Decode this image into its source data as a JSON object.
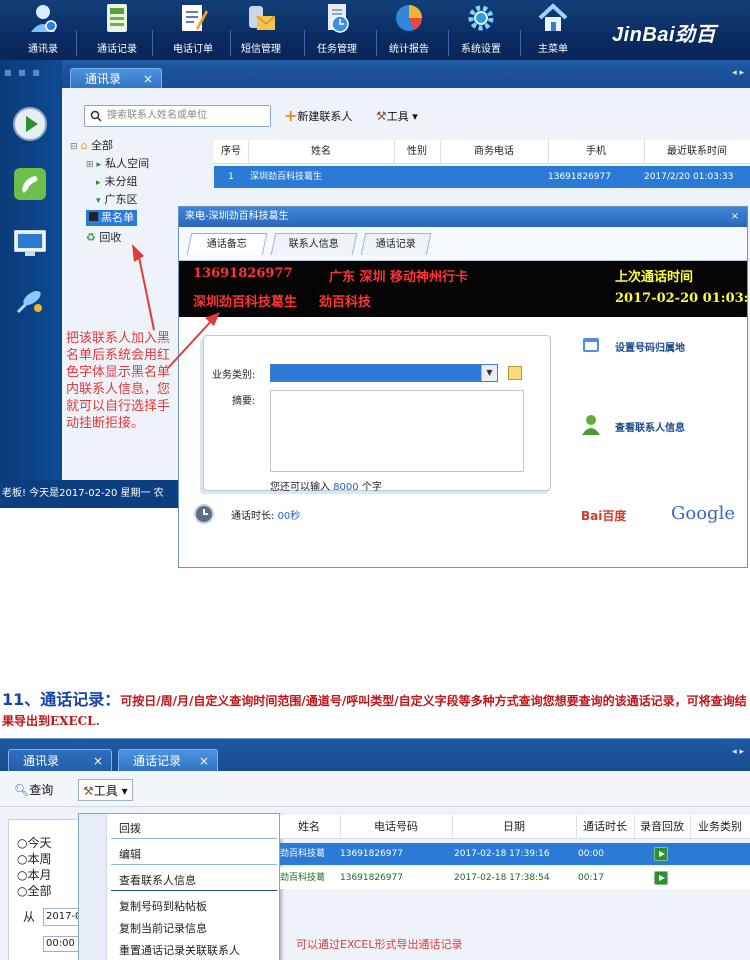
{
  "toolbar": {
    "items": [
      {
        "label": "通讯录",
        "icon": "address-book-icon"
      },
      {
        "label": "通话记录",
        "icon": "call-log-icon"
      },
      {
        "label": "电话订单",
        "icon": "order-icon"
      },
      {
        "label": "短信管理",
        "icon": "sms-icon"
      },
      {
        "label": "任务管理",
        "icon": "task-icon"
      },
      {
        "label": "统计报告",
        "icon": "pie-chart-icon"
      },
      {
        "label": "系统设置",
        "icon": "gear-icon"
      },
      {
        "label": "主菜单",
        "icon": "home-icon"
      }
    ],
    "brand": "JinBai劲百"
  },
  "sidebar": {
    "status_text": "老板! 今天是2017-02-20 星期一 农"
  },
  "contacts_tab": {
    "label": "通讯录",
    "close": "×"
  },
  "search": {
    "placeholder": "搜索联系人姓名或单位"
  },
  "buttons": {
    "new_contact": "新建联系人",
    "tools": "工具",
    "tools_arrow": "▾"
  },
  "tree": {
    "all": "全部",
    "private": "私人空间",
    "ungrouped": "未分组",
    "guangdong": "广东区",
    "blacklist": "黑名单",
    "recycle": "回收"
  },
  "contact_table": {
    "headers": [
      "序号",
      "姓名",
      "性别",
      "商务电话",
      "手机",
      "最近联系时间"
    ],
    "row": [
      "1",
      "深圳劲百科技葛生",
      "",
      "",
      "13691826977",
      "2017/2/20 01:03:33"
    ]
  },
  "annotation": {
    "text": "把该联系人加入黑名单后系统会用红色字体显示黑名单内联系人信息，您就可以自行选择手动挂断拒接。"
  },
  "popup": {
    "title": "来电-深圳劲百科技葛生",
    "close": "×",
    "tabs": [
      "通话备忘",
      "联系人信息",
      "通话记录"
    ],
    "led_number": "13691826977",
    "led_region": "广东 深圳 移动神州行卡",
    "led_name": "深圳劲百科技葛生",
    "led_company": "劲百科技",
    "led_last_label": "上次通话时间",
    "led_last_time": "2017-02-20 01:03:33",
    "biz_label": "业务类别:",
    "summary_label": "摘要:",
    "remain_prefix": "您还可以输入",
    "remain_count": "8000",
    "remain_suffix": "个字",
    "duration_label": "通话时长:",
    "duration_value": "00秒",
    "link_set_region": "设置号码归属地",
    "link_view_contact": "查看联系人信息",
    "baidu": "Bai百度",
    "google": "Google"
  },
  "section11": {
    "number": "11、通话记录：",
    "text": "可按日/周/月/自定义查询时间范围/通道号/呼叫类型/自定义字段等多种方式查询您想要查询的该通话记录，可将查询结果导出到EXECL."
  },
  "shot2": {
    "tabs": [
      {
        "label": "通讯录",
        "close": "×"
      },
      {
        "label": "通话记录",
        "close": "×"
      }
    ],
    "query_button": "查询",
    "tools_button": "工具",
    "radios": [
      "○今天",
      "○本周",
      "○本月",
      "○全部"
    ],
    "from_label": "从",
    "from_date": "2017-0",
    "from_time": "00:00",
    "menu_items": [
      "回拨",
      "编辑",
      "查看联系人信息",
      "复制号码到粘帖板",
      "复制当前记录信息",
      "重置通话记录关联联系人"
    ],
    "grid_headers": [
      "姓名",
      "电话号码",
      "日期",
      "通话时长",
      "录音回放",
      "业务类别"
    ],
    "grid_rows": [
      [
        "劲百科技葛",
        "13691826977",
        "2017-02-18 17:39:16",
        "00:00"
      ],
      [
        "劲百科技葛",
        "13691826977",
        "2017-02-18 17:38:54",
        "00:17"
      ]
    ],
    "export_note": "可以通过EXCEL形式导出通话记录"
  }
}
